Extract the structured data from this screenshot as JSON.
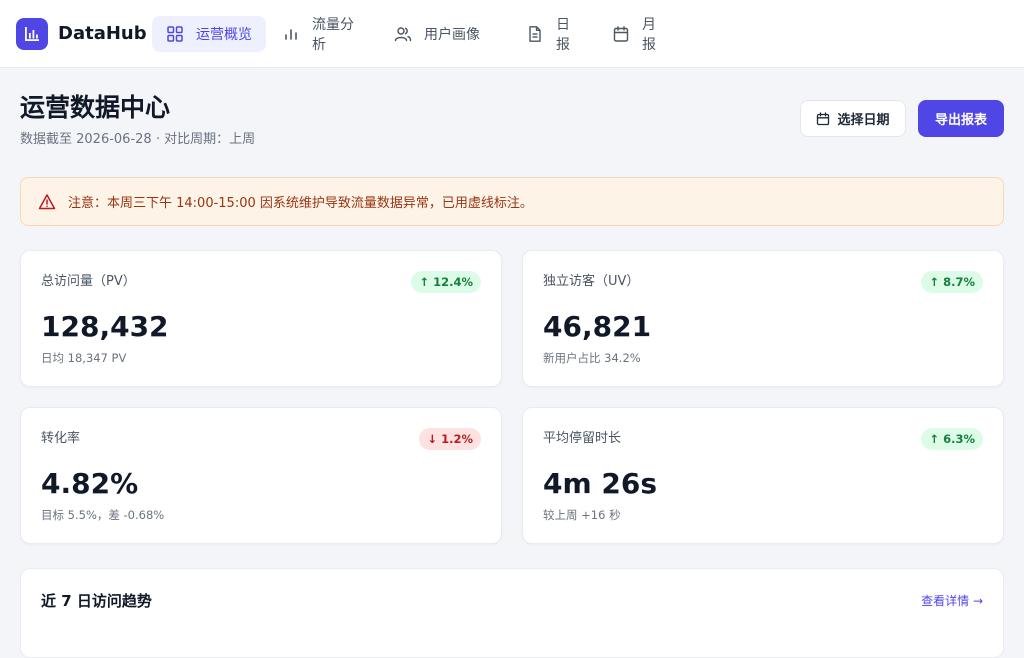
{
  "app": {
    "brand": "DataHub",
    "accent_color": "#4f46e5"
  },
  "nav": {
    "items": [
      {
        "label": "运营概览",
        "icon": "grid-icon",
        "active": true
      },
      {
        "label": "流量分析",
        "icon": "bar-chart-icon",
        "active": false
      },
      {
        "label": "用户画像",
        "icon": "users-icon",
        "active": false
      },
      {
        "label": "日报",
        "icon": "document-icon",
        "active": false
      },
      {
        "label": "月报",
        "icon": "calendar-icon",
        "active": false
      }
    ]
  },
  "header": {
    "title": "运营数据中心",
    "subtitle": "数据截至 2026-06-28 · 对比周期：上周",
    "date_button": "选择日期",
    "export_button": "导出报表"
  },
  "alert": {
    "text": "注意：本周三下午 14:00-15:00 因系统维护导致流量数据异常，已用虚线标注。",
    "icon": "warning-icon"
  },
  "metrics": [
    {
      "label": "总访问量（PV）",
      "value": "128,432",
      "note": "日均 18,347 PV",
      "change": "12.4%",
      "direction": "up"
    },
    {
      "label": "独立访客（UV）",
      "value": "46,821",
      "note": "新用户占比 34.2%",
      "change": "8.7%",
      "direction": "up"
    },
    {
      "label": "转化率",
      "value": "4.82%",
      "note": "目标 5.5%，差 -0.68%",
      "change": "1.2%",
      "direction": "down"
    },
    {
      "label": "平均停留时长",
      "value": "4m 26s",
      "note": "较上周 +16 秒",
      "change": "6.3%",
      "direction": "up"
    }
  ],
  "arrows": {
    "up": "↑",
    "down": "↓"
  },
  "trend": {
    "title": "近 7 日访问趋势",
    "link": "查看详情 →"
  }
}
